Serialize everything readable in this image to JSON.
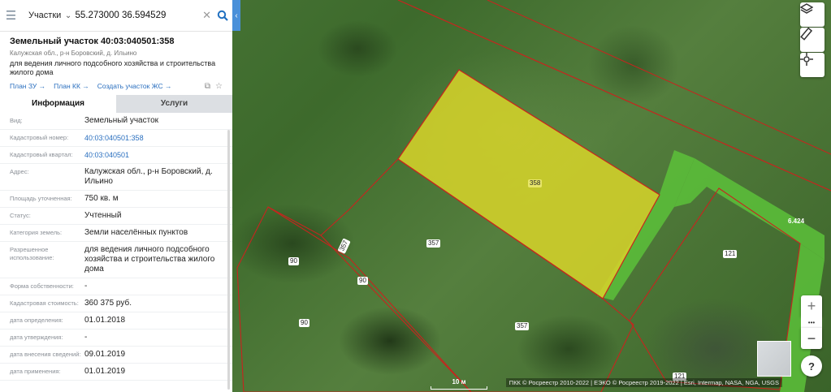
{
  "search": {
    "category": "Участки",
    "query": "55.273000 36.594529"
  },
  "plot": {
    "title": "Земельный участок 40:03:040501:358",
    "address_short": "Калужская обл., р-н Боровский, д. Ильино",
    "purpose_short": "для ведения личного подсобного хозяйства и строительства жилого дома"
  },
  "links": [
    "План ЗУ →",
    "План КК →",
    "Создать участок ЖС →"
  ],
  "tabs": {
    "info": "Информация",
    "services": "Услуги"
  },
  "fields": [
    {
      "key": "Вид:",
      "value": "Земельный участок"
    },
    {
      "key": "Кадастровый номер:",
      "value": "40:03:040501:358",
      "link": true
    },
    {
      "key": "Кадастровый квартал:",
      "value": "40:03:040501",
      "link": true
    },
    {
      "key": "Адрес:",
      "value": "Калужская обл., р-н Боровский, д. Ильино"
    },
    {
      "key": "Площадь уточненная:",
      "value": "750 кв. м"
    },
    {
      "key": "Статус:",
      "value": "Учтенный"
    },
    {
      "key": "Категория земель:",
      "value": "Земли населённых пунктов"
    },
    {
      "key": "Разрешенное использование:",
      "value": "для ведения личного подсобного хозяйства и строительства жилого дома"
    },
    {
      "key": "Форма собственности:",
      "value": "-"
    },
    {
      "key": "Кадастровая стоимость:",
      "value": "360 375 руб."
    },
    {
      "key": "дата определения:",
      "value": "01.01.2018"
    },
    {
      "key": "дата утверждения:",
      "value": "-"
    },
    {
      "key": "дата внесения сведений:",
      "value": "09.01.2019"
    },
    {
      "key": "дата применения:",
      "value": "01.01.2019"
    }
  ],
  "map": {
    "plot_labels": [
      "358",
      "357",
      "357",
      "90",
      "90",
      "90",
      "357",
      "121",
      "121",
      "6.424"
    ],
    "scale_label": "10 м",
    "attribution": "ПКК © Росреестр 2010-2022 | ЕЭКО © Росреестр 2019-2022 | Esri, Intermap, NASA, NGA, USGS",
    "selected_fill_color": "#d4d22a",
    "boundary_color": "#c8241e",
    "road_color": "#5cc13a"
  },
  "icons": {
    "layers": "layers-icon",
    "ruler": "ruler-icon",
    "locate": "crosshair-icon",
    "zoom_in": "+",
    "more": "•••",
    "zoom_out": "−",
    "help": "?"
  }
}
